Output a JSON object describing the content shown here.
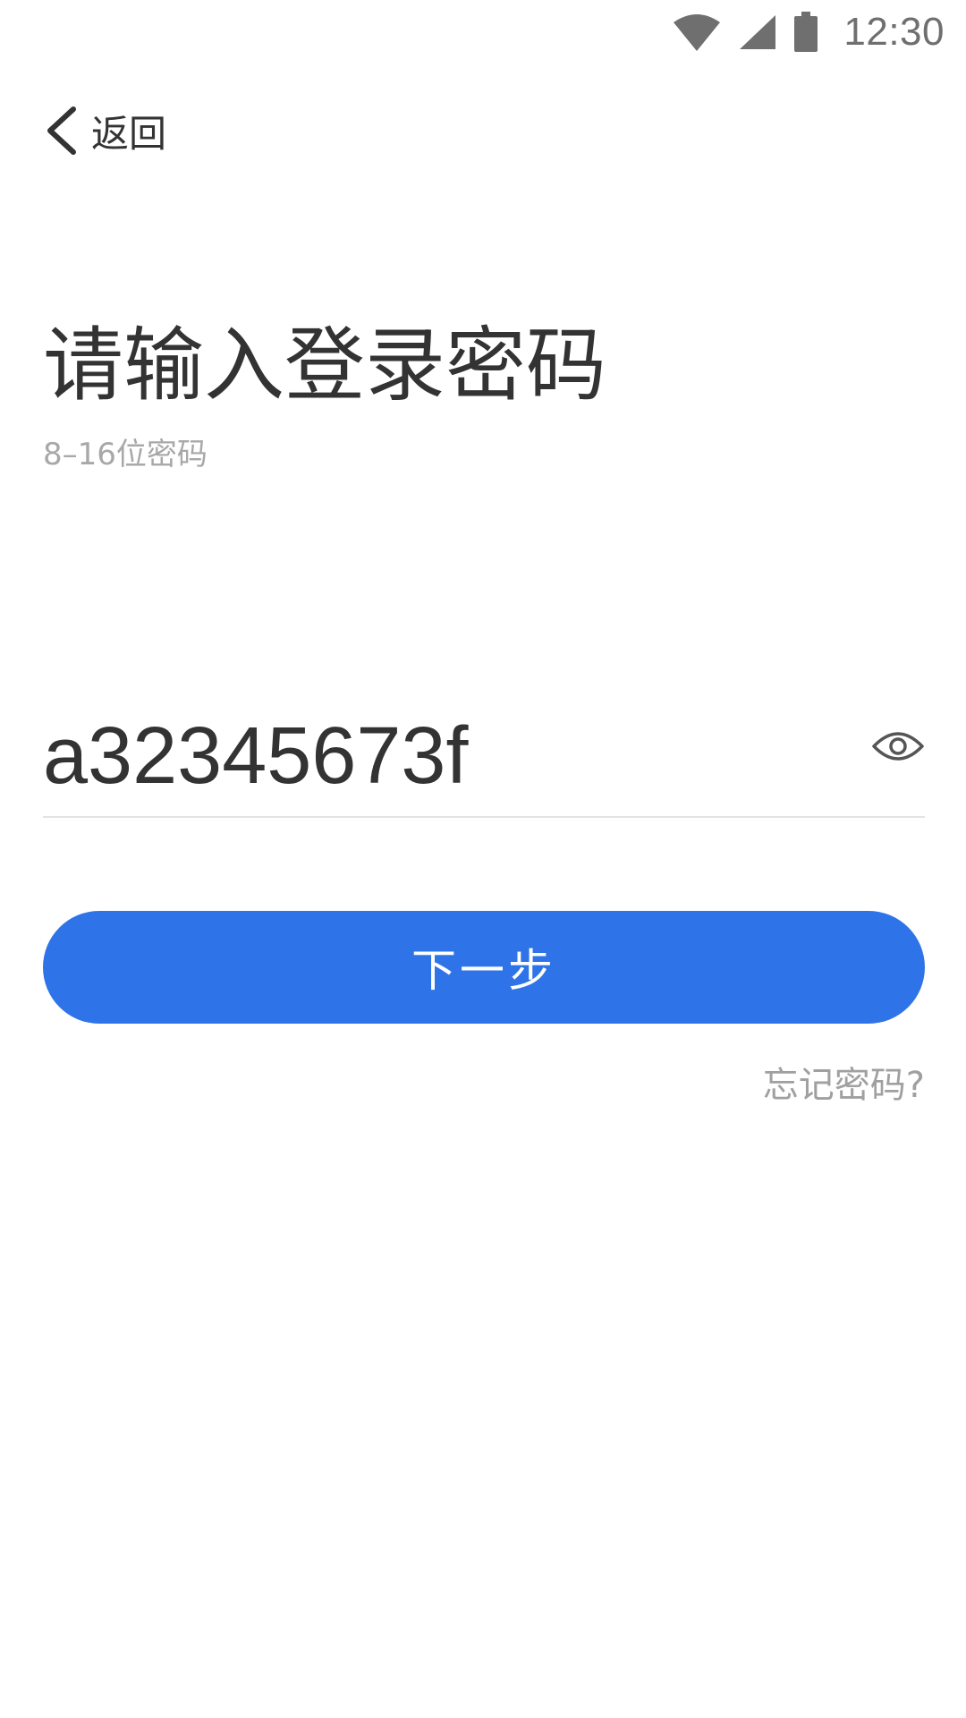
{
  "status_bar": {
    "time": "12:30",
    "icons": [
      "wifi-icon",
      "cellular-signal-icon",
      "battery-icon"
    ],
    "color": "#6f6f6f"
  },
  "nav": {
    "back_label": "返回",
    "back_icon": "chevron-left-icon"
  },
  "header": {
    "title": "请输入登录密码",
    "subtitle": "8–16位密码"
  },
  "password": {
    "value": "a32345673f",
    "visibility_icon": "eye-icon"
  },
  "actions": {
    "next_label": "下一步",
    "forgot_label": "忘记密码?"
  },
  "colors": {
    "primary": "#2e74e8",
    "text_primary": "#333333",
    "text_secondary": "#a8a8a8",
    "divider": "#e3e3e3"
  }
}
